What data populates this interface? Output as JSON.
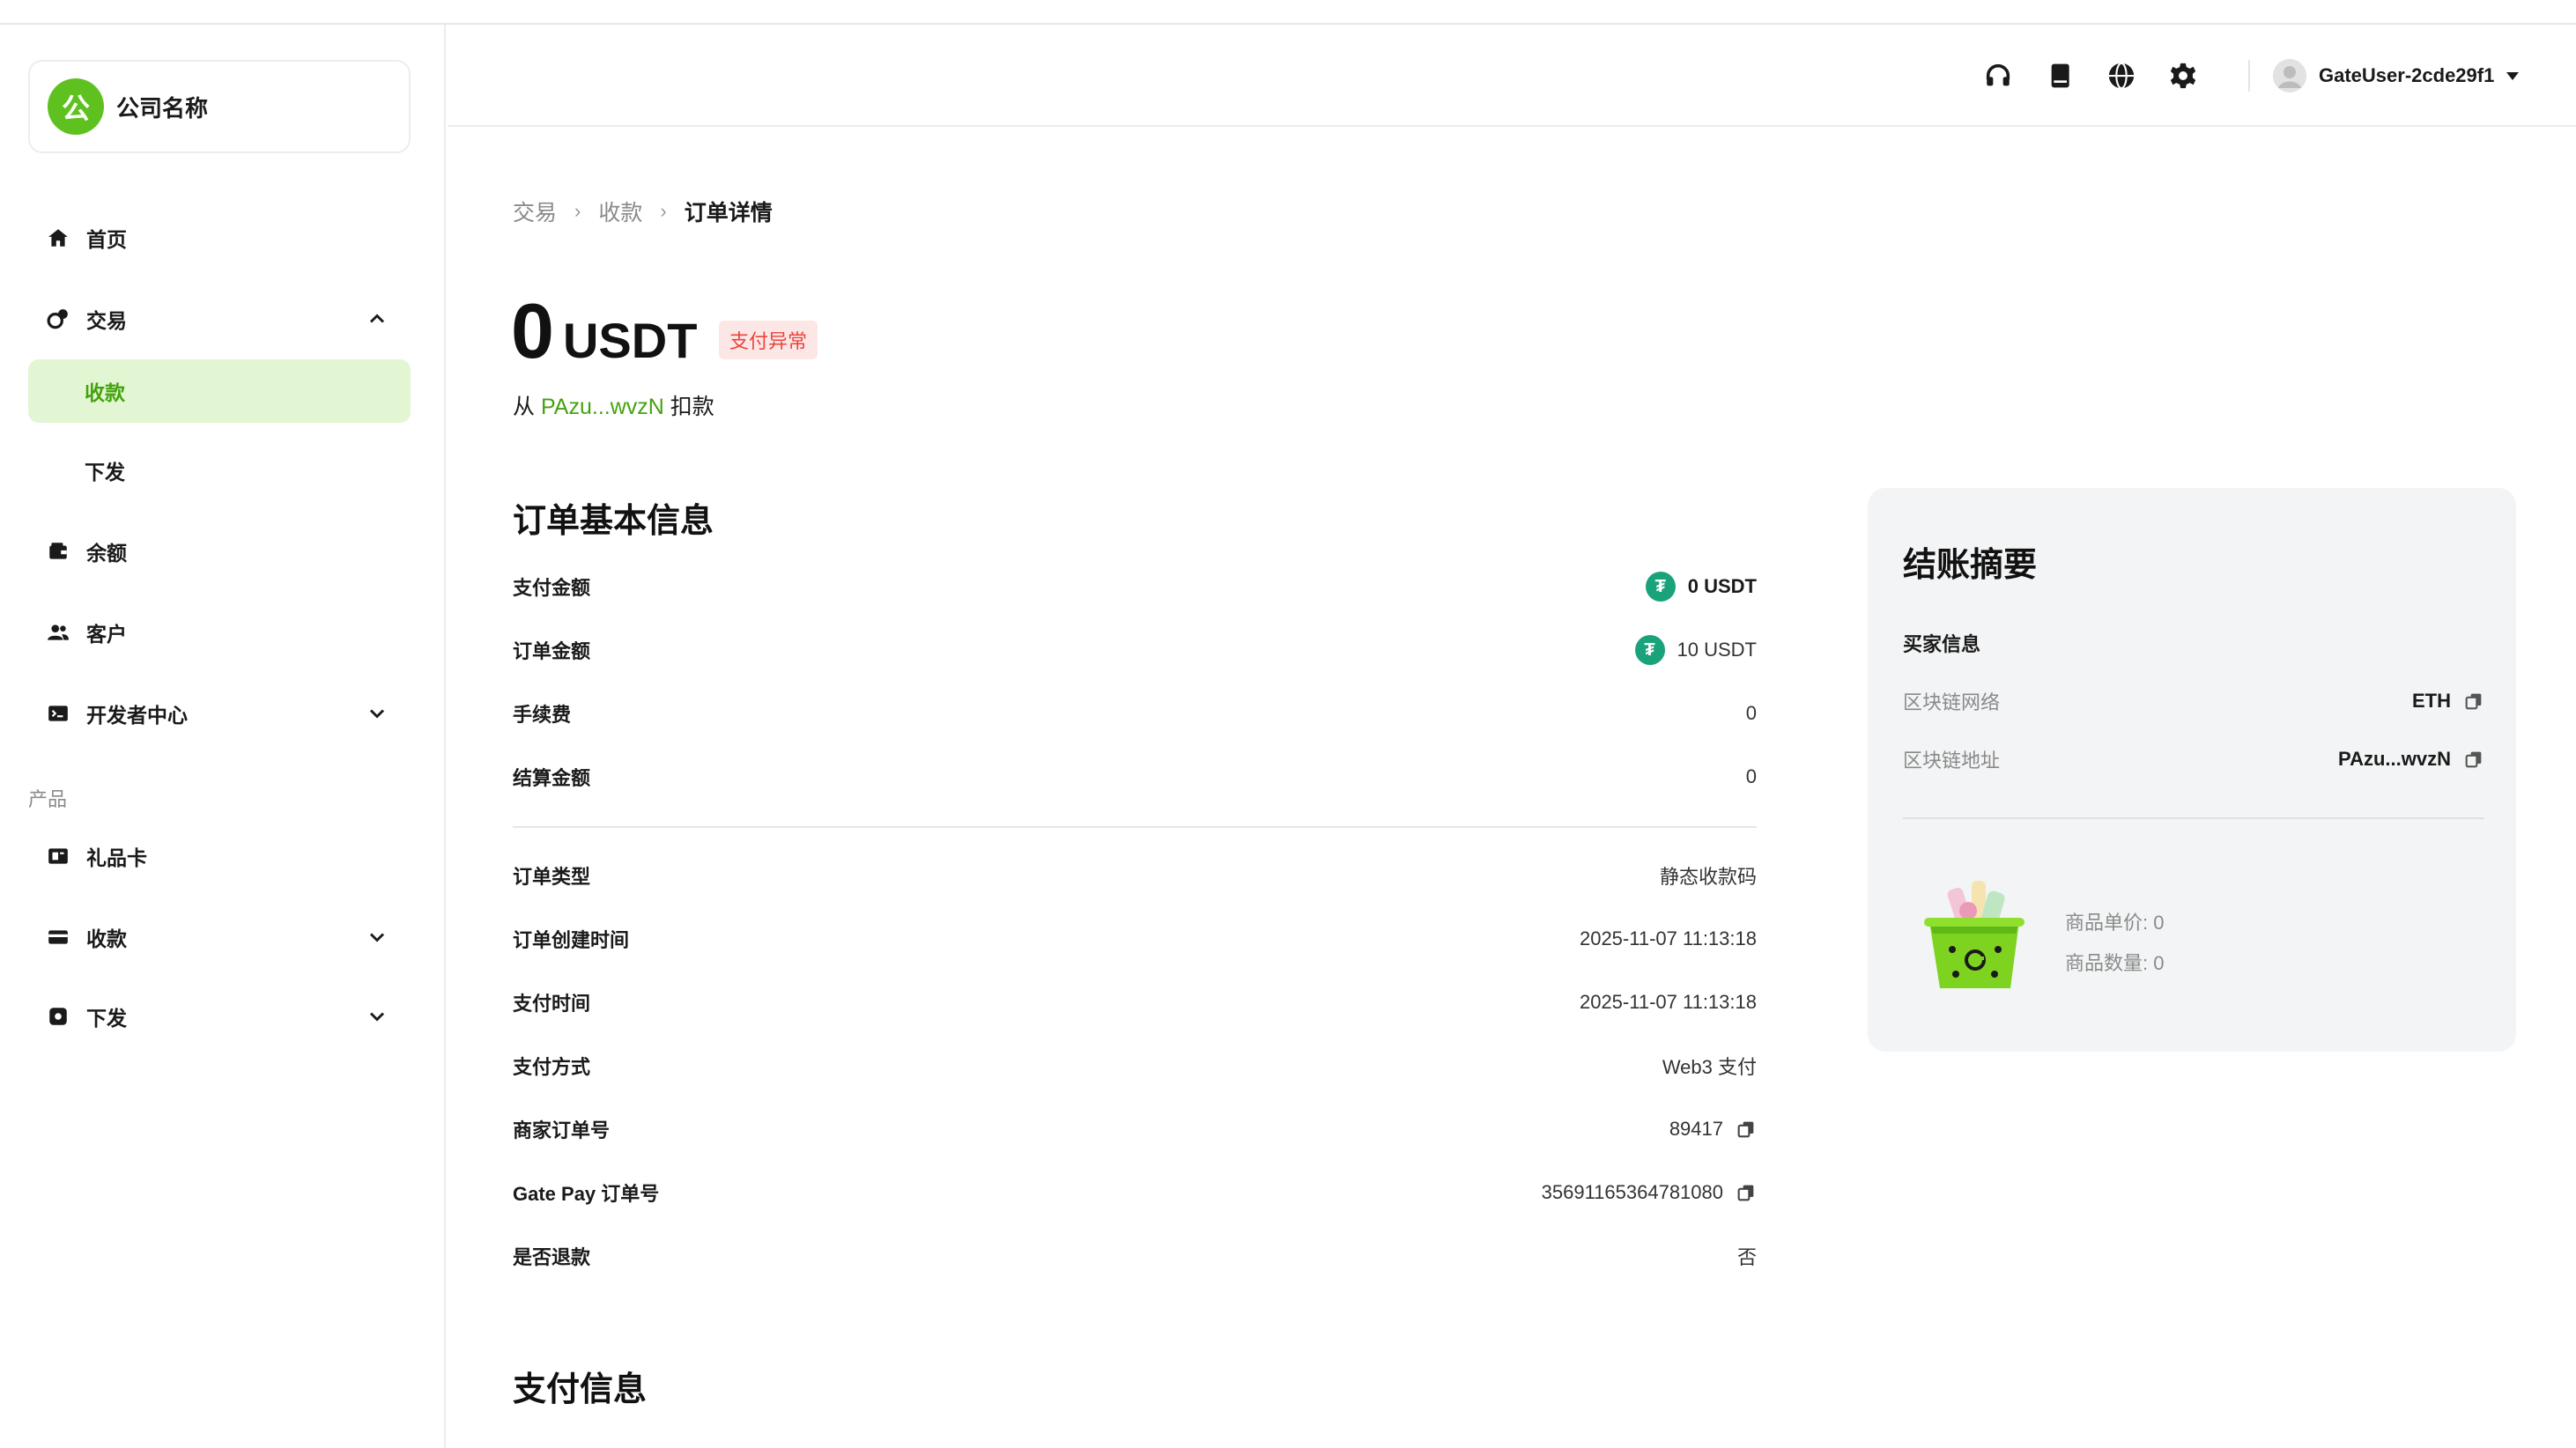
{
  "company": {
    "logo_char": "公",
    "name": "公司名称"
  },
  "sidebar": {
    "items": [
      {
        "label": "首页",
        "icon": "home-icon"
      },
      {
        "label": "交易",
        "icon": "exchange-icon"
      },
      {
        "label": "收款"
      },
      {
        "label": "下发"
      },
      {
        "label": "余额",
        "icon": "wallet-icon"
      },
      {
        "label": "客户",
        "icon": "users-icon"
      },
      {
        "label": "开发者中心",
        "icon": "terminal-icon"
      }
    ],
    "section_label": "产品",
    "product_items": [
      {
        "label": "礼品卡",
        "icon": "gift-card-icon"
      },
      {
        "label": "收款",
        "icon": "card-icon"
      },
      {
        "label": "下发",
        "icon": "payout-icon"
      }
    ]
  },
  "header": {
    "icons": [
      "headset-icon",
      "book-icon",
      "globe-icon",
      "gear-icon"
    ],
    "username": "GateUser-2cde29f1"
  },
  "breadcrumb": {
    "items": [
      "交易",
      "收款"
    ],
    "current": "订单详情"
  },
  "summary": {
    "amount": "0",
    "currency": "USDT",
    "status": "支付异常",
    "from_prefix": "从",
    "from_address": "PAzu...wvzN",
    "from_suffix": "扣款"
  },
  "order_info": {
    "title": "订单基本信息",
    "rows": [
      {
        "label": "支付金额",
        "value": "0 USDT"
      },
      {
        "label": "订单金额",
        "value": "10 USDT"
      },
      {
        "label": "手续费",
        "value": "0"
      },
      {
        "label": "结算金额",
        "value": "0"
      }
    ],
    "rows2": [
      {
        "label": "订单类型",
        "value": "静态收款码"
      },
      {
        "label": "订单创建时间",
        "value": "2025-11-07 11:13:18"
      },
      {
        "label": "支付时间",
        "value": "2025-11-07 11:13:18"
      },
      {
        "label": "支付方式",
        "value": "Web3 支付"
      },
      {
        "label": "商家订单号",
        "value": "89417"
      },
      {
        "label": "Gate Pay 订单号",
        "value": "35691165364781080"
      },
      {
        "label": "是否退款",
        "value": "否"
      }
    ]
  },
  "payment_info": {
    "title": "支付信息"
  },
  "checkout": {
    "title": "结账摘要",
    "buyer_title": "买家信息",
    "rows": [
      {
        "label": "区块链网络",
        "value": "ETH"
      },
      {
        "label": "区块链地址",
        "value": "PAzu...wvzN"
      }
    ],
    "unit_price": "商品单价: 0",
    "quantity": "商品数量: 0"
  },
  "colors": {
    "accent": "#44a20f",
    "logo": "#5fc11f",
    "active_bg": "#e3f6d4",
    "error": "#e8453c",
    "tether": "#1aa37a"
  }
}
